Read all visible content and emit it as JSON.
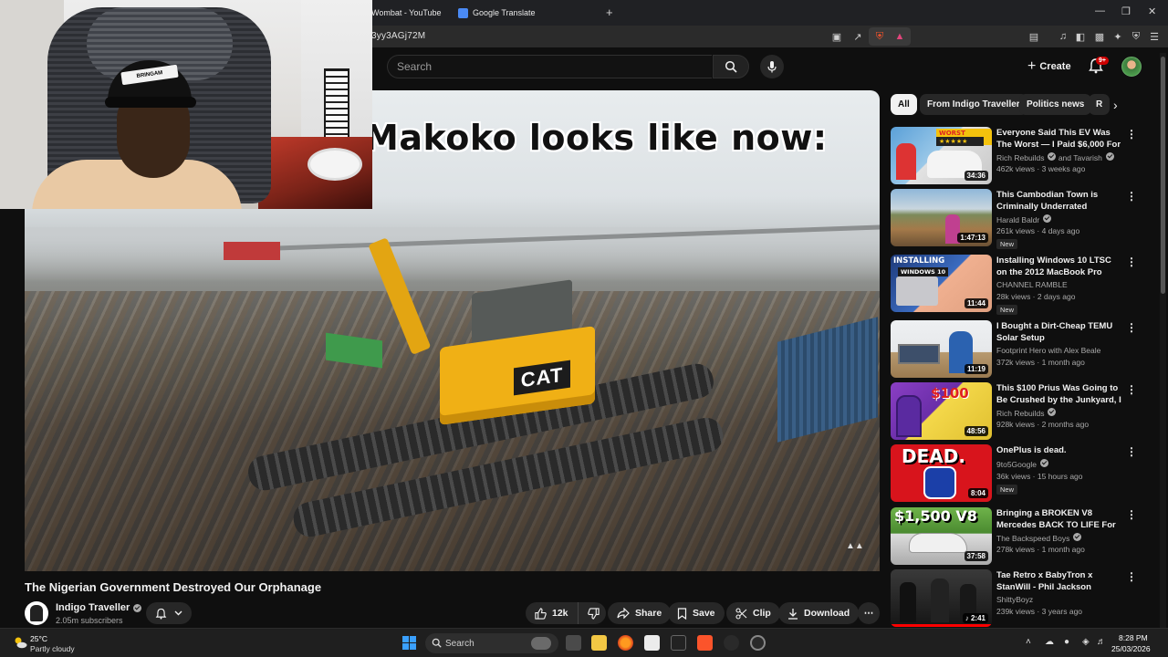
{
  "browser": {
    "tabs": [
      {
        "label": "Wombat - YouTube"
      },
      {
        "label": "Google Translate"
      }
    ],
    "new_tab": "+",
    "url": "3yy3AGj72M"
  },
  "youtube": {
    "search_placeholder": "Search",
    "create_label": "Create",
    "notifications_count": "9+"
  },
  "video": {
    "caption": "Makoko looks like now:",
    "title": "The Nigerian Government Destroyed Our Orphanage",
    "channel": "Indigo Traveller",
    "subscribers": "2.05m subscribers",
    "likes": "12k",
    "share": "Share",
    "save": "Save",
    "clip": "Clip",
    "download": "Download"
  },
  "sidebar": {
    "chips": [
      "All",
      "From Indigo Traveller",
      "Politics news",
      "R"
    ],
    "recommendations": [
      {
        "title": "Everyone Said This EV Was The Worst — I Paid $6,000 For One",
        "channel": "Rich Rebuilds",
        "channel_extra": "and Tavarish",
        "meta": "462k views · 3 weeks ago",
        "duration": "34:36",
        "thumb_text": "WORST RATED",
        "new": ""
      },
      {
        "title": "This Cambodian Town is Criminally Underrated",
        "channel": "Harald Baldr",
        "meta": "261k views · 4 days ago",
        "duration": "1:47:13",
        "new": "New"
      },
      {
        "title": "Installing Windows 10 LTSC on the 2012 MacBook Pro",
        "channel": "CHANNEL RAMBLE",
        "meta": "28k views · 2 days ago",
        "duration": "11:44",
        "thumb_text": "INSTALLING",
        "thumb_text2": "WINDOWS 10",
        "new": "New"
      },
      {
        "title": "I Bought a Dirt-Cheap TEMU Solar Setup",
        "channel": "Footprint Hero with Alex Beale",
        "meta": "372k views · 1 month ago",
        "duration": "11:19",
        "new": ""
      },
      {
        "title": "This $100 Prius Was Going to Be Crushed by the Junkyard, I ...",
        "channel": "Rich Rebuilds",
        "meta": "928k views · 2 months ago",
        "duration": "48:56",
        "thumb_text": "$100",
        "new": ""
      },
      {
        "title": "OnePlus is dead.",
        "channel": "9to5Google",
        "meta": "36k views · 15 hours ago",
        "duration": "8:04",
        "thumb_text": "DEAD.",
        "new": "New"
      },
      {
        "title": "Bringing a BROKEN V8 Mercedes BACK TO LIFE For ...",
        "channel": "The Backspeed Boys",
        "meta": "278k views · 1 month ago",
        "duration": "37:58",
        "thumb_text": "$1,500 V8",
        "new": ""
      },
      {
        "title": "Tae Retro x BabyTron x StanWill - Phil Jackson (Official Video)",
        "channel": "ShittyBoyz",
        "meta": "239k views · 3 years ago",
        "duration": "2:41",
        "new": ""
      }
    ]
  },
  "webcam": {
    "cap_text": "BRINGAM"
  },
  "taskbar": {
    "temperature": "25°C",
    "weather": "Partly cloudy",
    "search": "Search",
    "time": "8:28 PM",
    "date": "25/03/2026"
  },
  "colors": {
    "accent_red": "#cc0000",
    "chip_bg": "#272727",
    "bg": "#0f0f0f"
  }
}
